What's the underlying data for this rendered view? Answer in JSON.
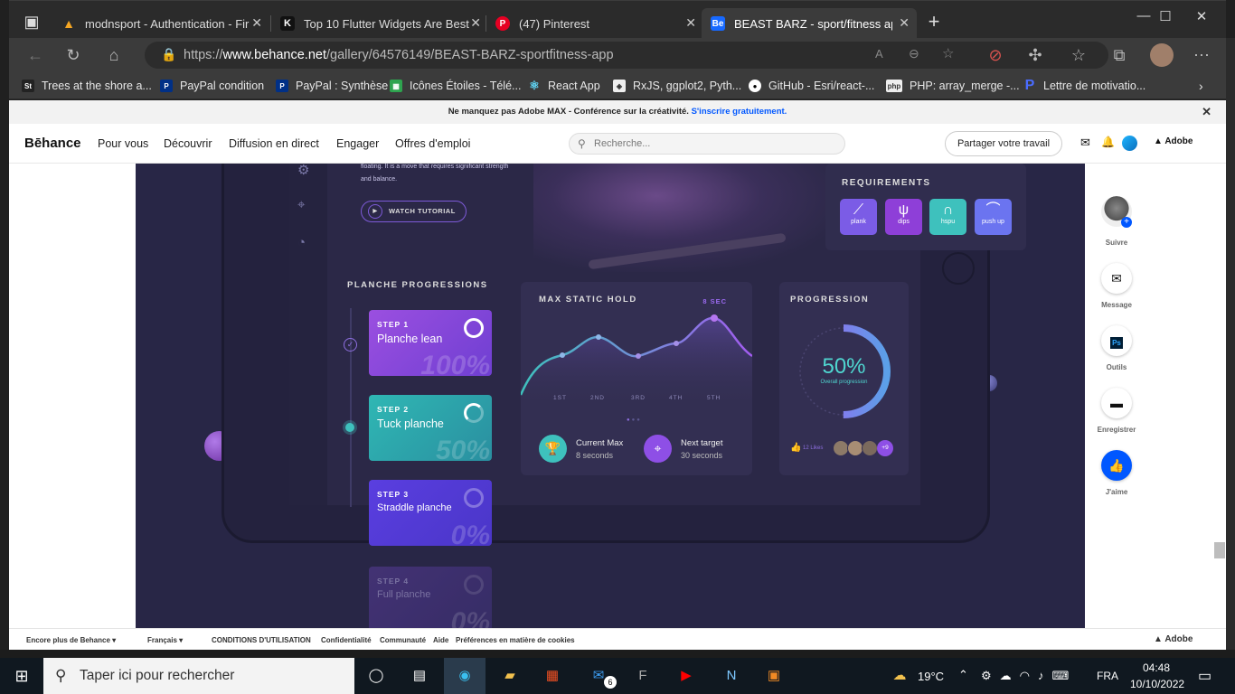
{
  "browser": {
    "tabs": [
      {
        "title": "modnsport - Authentication - Fir",
        "icon": "firebase-icon"
      },
      {
        "title": "Top 10 Flutter Widgets Are Best",
        "icon": "k-icon"
      },
      {
        "title": "(47) Pinterest",
        "icon": "pinterest-icon"
      },
      {
        "title": "BEAST BARZ - sport/fitness app",
        "icon": "behance-icon"
      }
    ],
    "url_prefix": "https://",
    "url_host": "www.behance.net",
    "url_path": "/gallery/64576149/BEAST-BARZ-sportfitness-app",
    "bookmarks": [
      "Trees at the shore a...",
      "PayPal condition",
      "PayPal : Synthèse",
      "Icônes Étoiles - Télé...",
      "React App",
      "RxJS, ggplot2, Pyth...",
      "GitHub - Esri/react-...",
      "PHP: array_merge -...",
      "Lettre de motivatio..."
    ]
  },
  "banner": {
    "text": "Ne manquez pas Adobe MAX - Conférence sur la créativité.",
    "link": "S'inscrire gratuitement."
  },
  "behance": {
    "logo": "Bēhance",
    "nav": [
      "Pour vous",
      "Découvrir",
      "Diffusion en direct",
      "Engager",
      "Offres d'emploi"
    ],
    "search_placeholder": "Recherche...",
    "share": "Partager votre travail",
    "adobe": "Adobe"
  },
  "art": {
    "intro_1": "floating. It is a move that requires significant strength",
    "intro_2": "and balance.",
    "watch": "WATCH TUTORIAL",
    "requirements_title": "REQUIREMENTS",
    "requirements": [
      {
        "label": "plank",
        "color": "#7b5ce6"
      },
      {
        "label": "dips",
        "color": "#8e3fd8"
      },
      {
        "label": "hspu",
        "color": "#3ec1bd"
      },
      {
        "label": "push up",
        "color": "#6b74f0"
      }
    ],
    "progressions_title": "PLANCHE PROGRESSIONS",
    "steps": [
      {
        "num": "STEP 1",
        "label": "Planche lean",
        "pct": "100%"
      },
      {
        "num": "STEP 2",
        "label": "Tuck planche",
        "pct": "50%"
      },
      {
        "num": "STEP 3",
        "label": "Straddle planche",
        "pct": "0%"
      },
      {
        "num": "STEP 4",
        "label": "Full planche",
        "pct": "0%"
      }
    ],
    "max_title": "MAX STATIC HOLD",
    "max_badge": "8 SEC",
    "ticks": [
      "1ST",
      "2ND",
      "3RD",
      "4TH",
      "5TH"
    ],
    "current_label": "Current Max",
    "current_value": "8 seconds",
    "next_label": "Next target",
    "next_value": "30 seconds",
    "progression_title": "PROGRESSION",
    "progress_value": "50%",
    "progress_fraction": 0.5,
    "progress_caption": "Overall progression",
    "likes": "12 Likes",
    "more": "+9"
  },
  "rail": [
    "Suivre",
    "Message",
    "Outils",
    "Enregistrer",
    "J'aime"
  ],
  "footer": [
    "Encore plus de Behance ▾",
    "Français ▾",
    "CONDITIONS D'UTILISATION",
    "Confidentialité",
    "Communauté",
    "Aide",
    "Préférences en matière de cookies"
  ],
  "taskbar": {
    "search": "Taper ici pour rechercher",
    "weather": "19°C",
    "lang": "FRA",
    "time": "04:48",
    "date": "10/10/2022",
    "mail_badge": "6"
  }
}
